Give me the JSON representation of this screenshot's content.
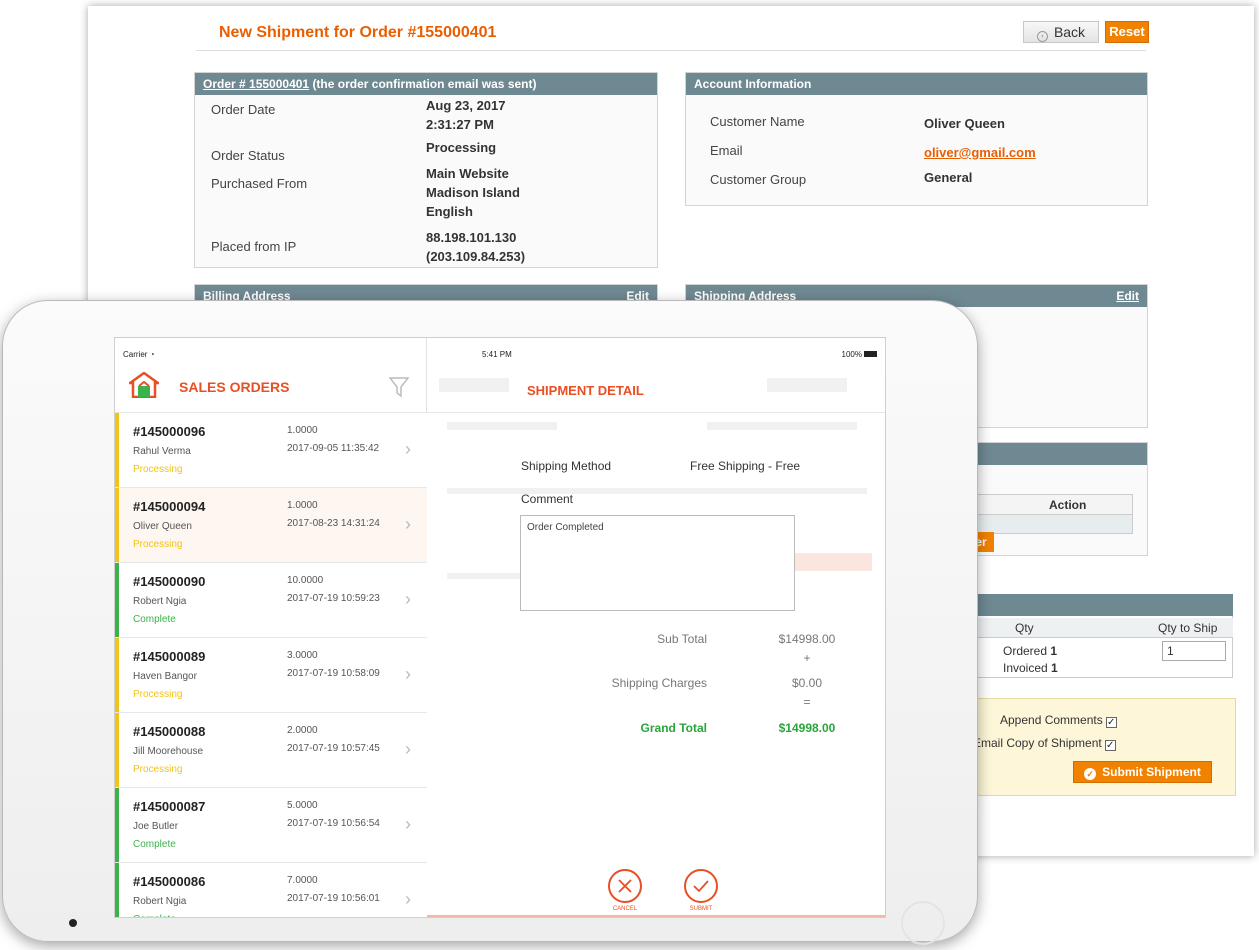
{
  "admin": {
    "title": "New Shipment for Order #155000401",
    "back_label": "Back",
    "reset_label": "Reset",
    "order_box": {
      "order_link": "Order # 155000401",
      "header_suffix": "(the order confirmation email was sent)",
      "rows": [
        {
          "label": "Order Date",
          "value_lines": [
            "Aug 23, 2017",
            "2:31:27 PM"
          ]
        },
        {
          "label": "Order Status",
          "value_lines": [
            "Processing"
          ]
        },
        {
          "label": "Purchased From",
          "value_lines": [
            "Main Website",
            "Madison Island",
            "English"
          ]
        },
        {
          "label": "Placed from IP",
          "value_lines": [
            "88.198.101.130",
            "(203.109.84.253)"
          ]
        }
      ]
    },
    "account_box": {
      "header": "Account Information",
      "customer_name_label": "Customer Name",
      "customer_name": "Oliver Queen",
      "email_label": "Email",
      "email": "oliver@gmail.com",
      "group_label": "Customer Group",
      "group": "General"
    },
    "billing_header": "Billing Address",
    "shipping_header": "Shipping Address",
    "edit_label": "Edit",
    "action_header": "Action",
    "action_button_fragment": "er",
    "qty": {
      "col_qty": "Qty",
      "col_qty_to_ship": "Qty to Ship",
      "ordered_label": "Ordered",
      "ordered": "1",
      "invoiced_label": "Invoiced",
      "invoiced": "1",
      "qty_to_ship_value": "1"
    },
    "append_comments_label": "Append Comments",
    "email_copy_label": "Email Copy of Shipment",
    "submit_shipment_label": "Submit Shipment"
  },
  "tablet": {
    "carrier": "Carrier",
    "time": "5:41 PM",
    "battery": "100%",
    "sales_title": "SALES ORDERS",
    "orders": [
      {
        "number": "#145000096",
        "customer": "Rahul Verma",
        "status": "Processing",
        "amount": "1.0000",
        "date": "2017-09-05 11:35:42"
      },
      {
        "number": "#145000094",
        "customer": "Oliver Queen",
        "status": "Processing",
        "amount": "1.0000",
        "date": "2017-08-23 14:31:24"
      },
      {
        "number": "#145000090",
        "customer": "Robert Ngia",
        "status": "Complete",
        "amount": "10.0000",
        "date": "2017-07-19 10:59:23"
      },
      {
        "number": "#145000089",
        "customer": "Haven Bangor",
        "status": "Processing",
        "amount": "3.0000",
        "date": "2017-07-19 10:58:09"
      },
      {
        "number": "#145000088",
        "customer": "Jill Moorehouse",
        "status": "Processing",
        "amount": "2.0000",
        "date": "2017-07-19 10:57:45"
      },
      {
        "number": "#145000087",
        "customer": "Joe Butler",
        "status": "Complete",
        "amount": "5.0000",
        "date": "2017-07-19 10:56:54"
      },
      {
        "number": "#145000086",
        "customer": "Robert Ngia",
        "status": "Complete",
        "amount": "7.0000",
        "date": "2017-07-19 10:56:01"
      }
    ],
    "detail": {
      "title": "SHIPMENT DETAIL",
      "shipping_method_label": "Shipping Method",
      "shipping_method": "Free Shipping - Free",
      "comment_label": "Comment",
      "comment": "Order Completed",
      "sub_total_label": "Sub Total",
      "sub_total": "$14998.00",
      "plus": "+",
      "shipping_charges_label": "Shipping Charges",
      "shipping_charges": "$0.00",
      "equals": "=",
      "grand_total_label": "Grand Total",
      "grand_total": "$14998.00",
      "cancel_label": "CANCEL",
      "submit_label": "SUBMIT"
    }
  },
  "colors": {
    "accent": "#e84f25",
    "admin_orange": "#f18200",
    "header_gray": "#6f8992",
    "processing": "#f2c318",
    "complete": "#3cb34a",
    "grand_total": "#2aa43c"
  }
}
